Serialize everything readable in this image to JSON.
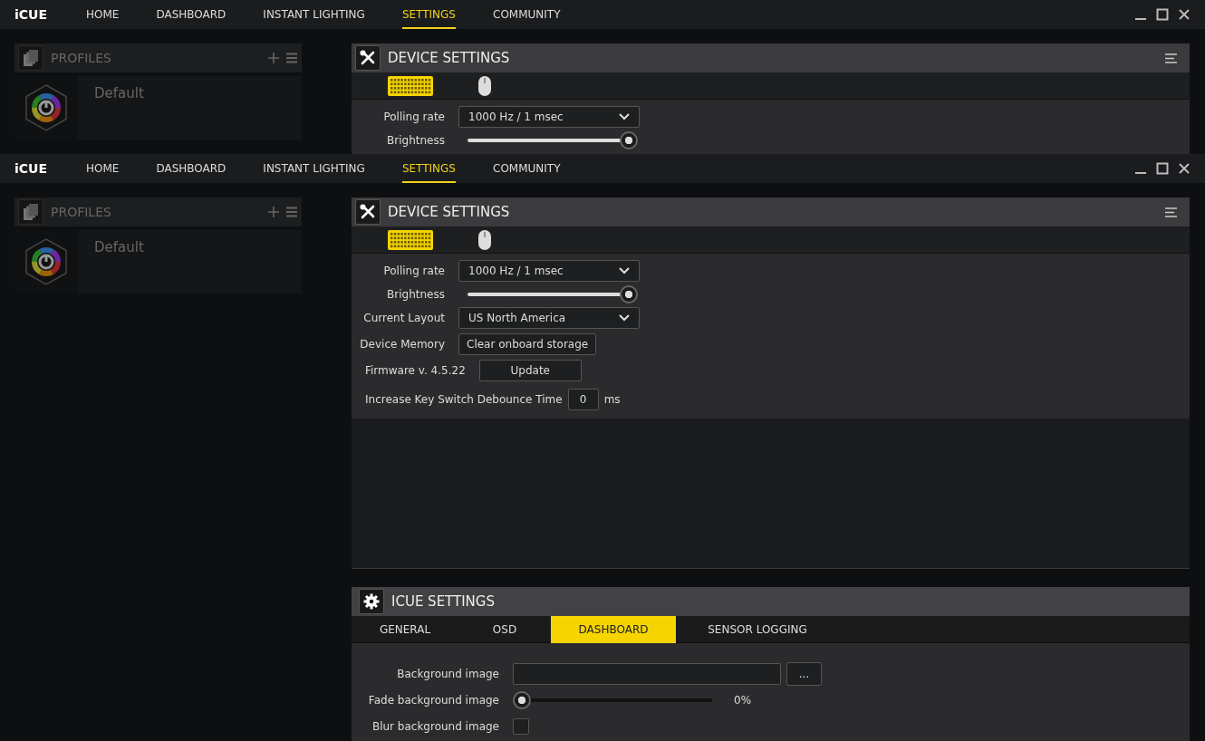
{
  "windows": [
    {
      "app_name": "iCUE",
      "nav": [
        {
          "label": "HOME",
          "selected": false
        },
        {
          "label": "DASHBOARD",
          "selected": false
        },
        {
          "label": "INSTANT LIGHTING",
          "selected": false
        },
        {
          "label": "SETTINGS",
          "selected": true
        },
        {
          "label": "COMMUNITY",
          "selected": false
        }
      ],
      "profiles": {
        "title": "PROFILES",
        "items": [
          {
            "name": "Default"
          }
        ]
      },
      "device_settings": {
        "title": "DEVICE SETTINGS",
        "devices": [
          {
            "kind": "keyboard",
            "selected": true
          },
          {
            "kind": "mouse",
            "selected": false
          }
        ],
        "rows": [
          {
            "kind": "dropdown",
            "label": "Polling rate",
            "value": "1000 Hz / 1 msec"
          },
          {
            "kind": "slider",
            "label": "Brightness",
            "level": 1.0
          }
        ]
      }
    },
    {
      "app_name": "iCUE",
      "nav": [
        {
          "label": "HOME",
          "selected": false
        },
        {
          "label": "DASHBOARD",
          "selected": false
        },
        {
          "label": "INSTANT LIGHTING",
          "selected": false
        },
        {
          "label": "SETTINGS",
          "selected": true
        },
        {
          "label": "COMMUNITY",
          "selected": false
        }
      ],
      "profiles": {
        "title": "PROFILES",
        "items": [
          {
            "name": "Default"
          }
        ]
      },
      "device_settings": {
        "title": "DEVICE SETTINGS",
        "devices": [
          {
            "kind": "keyboard",
            "selected": true
          },
          {
            "kind": "mouse",
            "selected": false
          }
        ],
        "rows": [
          {
            "kind": "dropdown",
            "label": "Polling rate",
            "value": "1000 Hz / 1 msec"
          },
          {
            "kind": "slider",
            "label": "Brightness",
            "level": 1.0
          },
          {
            "kind": "dropdown",
            "label": "Current Layout",
            "value": "US North America"
          },
          {
            "kind": "button",
            "label": "Device Memory",
            "button": "Clear onboard storage"
          },
          {
            "kind": "wide_button",
            "label": "Firmware v. 4.5.22",
            "button": "Update"
          },
          {
            "kind": "number",
            "label": "Increase Key Switch Debounce Time",
            "value": "0",
            "unit": "ms"
          }
        ]
      },
      "icue_settings": {
        "title": "ICUE SETTINGS",
        "tabs": [
          {
            "label": "GENERAL",
            "selected": false
          },
          {
            "label": "OSD",
            "selected": false
          },
          {
            "label": "DASHBOARD",
            "selected": true
          },
          {
            "label": "SENSOR LOGGING",
            "selected": false
          }
        ],
        "rows": [
          {
            "kind": "file",
            "label": "Background image",
            "button": "..."
          },
          {
            "kind": "slider",
            "label": "Fade background image",
            "level": 0,
            "reading": "0%"
          },
          {
            "kind": "checkbox",
            "label": "Blur background image",
            "checked": false
          }
        ]
      }
    }
  ]
}
